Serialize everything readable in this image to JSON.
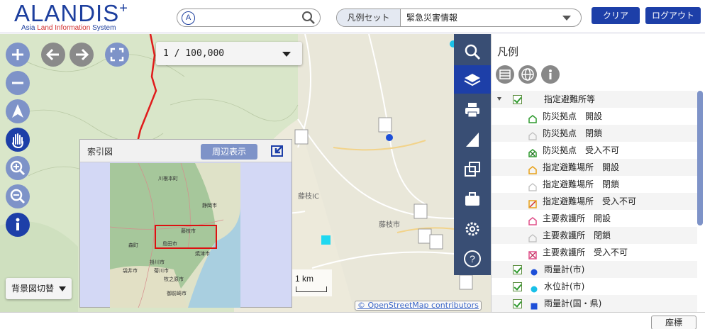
{
  "header": {
    "logo_main": "ALANDIS",
    "logo_plus": "+",
    "logo_sub_parts": [
      "Asia ",
      "Land ",
      "Information ",
      "System"
    ],
    "search_mode": "A",
    "search_placeholder": "",
    "legendset_label": "凡例セット",
    "legendset_value": "緊急災害情報",
    "clear_label": "クリア",
    "logout_label": "ログアウト"
  },
  "map": {
    "scale_value": "1 / 100,000",
    "index_title": "索引図",
    "index_around_label": "周辺表示",
    "basemap_label": "背景図切替",
    "scalebar_label": "1 km",
    "attribution": "© OpenStreetMap contributors"
  },
  "legend": {
    "title": "凡例",
    "items": [
      {
        "label": "指定避難所等",
        "level": 0,
        "checkbox": true,
        "expander": true,
        "symbol": ""
      },
      {
        "label": "防災拠点　開設",
        "level": 1,
        "checkbox": false,
        "expander": false,
        "symbol": "hut-green"
      },
      {
        "label": "防災拠点　閉鎖",
        "level": 1,
        "checkbox": false,
        "expander": false,
        "symbol": "hut-gray"
      },
      {
        "label": "防災拠点　受入不可",
        "level": 1,
        "checkbox": false,
        "expander": false,
        "symbol": "hut-green-x"
      },
      {
        "label": "指定避難場所　開設",
        "level": 1,
        "checkbox": false,
        "expander": false,
        "symbol": "hut-orange"
      },
      {
        "label": "指定避難場所　閉鎖",
        "level": 1,
        "checkbox": false,
        "expander": false,
        "symbol": "hut-gray"
      },
      {
        "label": "指定避難場所　受入不可",
        "level": 1,
        "checkbox": false,
        "expander": false,
        "symbol": "hut-orange-x"
      },
      {
        "label": "主要救護所　開設",
        "level": 1,
        "checkbox": false,
        "expander": false,
        "symbol": "hut-pink"
      },
      {
        "label": "主要救護所　閉鎖",
        "level": 1,
        "checkbox": false,
        "expander": false,
        "symbol": "hut-gray"
      },
      {
        "label": "主要救護所　受入不可",
        "level": 1,
        "checkbox": false,
        "expander": false,
        "symbol": "hut-pink-x"
      },
      {
        "label": "雨量計(市)",
        "level": 0,
        "checkbox": true,
        "expander": false,
        "symbol": "dot-blue"
      },
      {
        "label": "水位計(市)",
        "level": 0,
        "checkbox": true,
        "expander": false,
        "symbol": "dot-cyan"
      },
      {
        "label": "雨量計(国・県)",
        "level": 0,
        "checkbox": true,
        "expander": false,
        "symbol": "square-blue"
      }
    ]
  },
  "index_map_labels": [
    "川根本町",
    "静岡市",
    "藤枝市",
    "島田市",
    "焼津市",
    "掛川市",
    "菊川市",
    "袋井市",
    "牧之原市",
    "御前崎市",
    "森町"
  ],
  "map_labels": [
    "藤枝IC",
    "藤枝市"
  ],
  "footer": {
    "coords_label": "座標"
  },
  "colors": {
    "accent": "#1d3fa8",
    "button_light": "#7e93c8",
    "tool_column": "#394e74",
    "route": "#e01b1b"
  }
}
